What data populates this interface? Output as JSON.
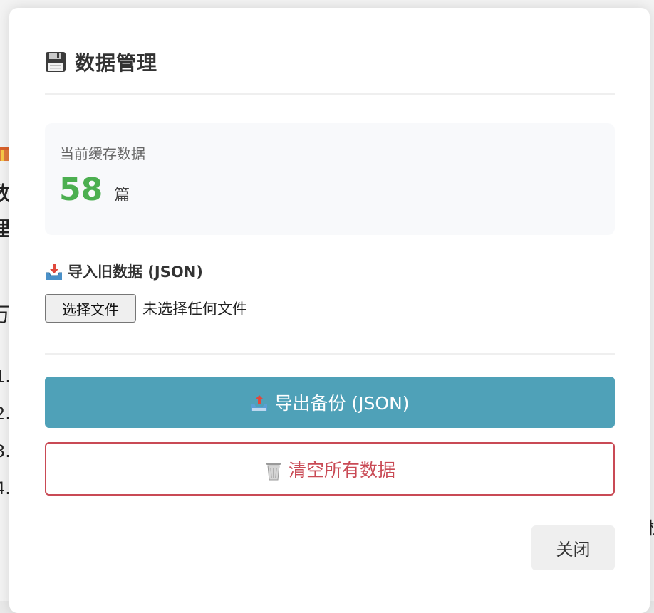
{
  "background": {
    "fragments": [
      "数",
      "理",
      "万",
      "1.",
      "2.",
      "3.",
      "4.",
      "栏"
    ]
  },
  "modal": {
    "title": "数据管理",
    "title_icon": "floppy-disk-icon",
    "stats": {
      "label": "当前缓存数据",
      "count": "58",
      "unit": "篇",
      "count_color": "#4caf50"
    },
    "import": {
      "icon": "inbox-tray-icon",
      "heading": "导入旧数据 (JSON)",
      "choose_button": "选择文件",
      "file_status": "未选择任何文件"
    },
    "export_button": {
      "icon": "outbox-tray-icon",
      "label": "导出备份 (JSON)",
      "color": "#4fa1b8"
    },
    "clear_button": {
      "icon": "trash-can-icon",
      "label": "清空所有数据",
      "color": "#c94a55"
    },
    "close_button": "关闭"
  }
}
